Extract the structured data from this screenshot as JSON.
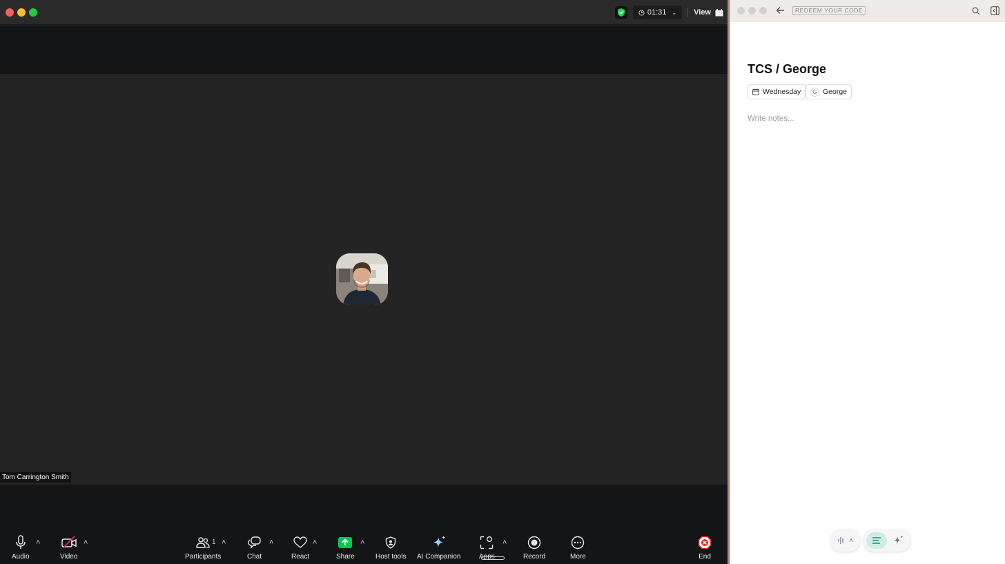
{
  "zoom": {
    "timer": "01:31",
    "view_label": "View",
    "participant_name": "Tom Carrington Smith",
    "toolbar": {
      "audio": "Audio",
      "video": "Video",
      "participants": "Participants",
      "participants_count": "1",
      "chat": "Chat",
      "react": "React",
      "share": "Share",
      "host_tools": "Host tools",
      "ai_companion": "AI Companion",
      "apps": "Apps",
      "record": "Record",
      "more": "More",
      "end": "End"
    },
    "colors": {
      "share_green": "#00c853",
      "end_red": "#e02828",
      "shield_green": "#1ed760"
    }
  },
  "notes": {
    "redeem_label": "REDEEM YOUR CODE",
    "title": "TCS / George",
    "chip_date": "Wednesday",
    "chip_person_initial": "G",
    "chip_person": "George",
    "placeholder": "Write notes...",
    "accent_color": "#cdeee5"
  }
}
